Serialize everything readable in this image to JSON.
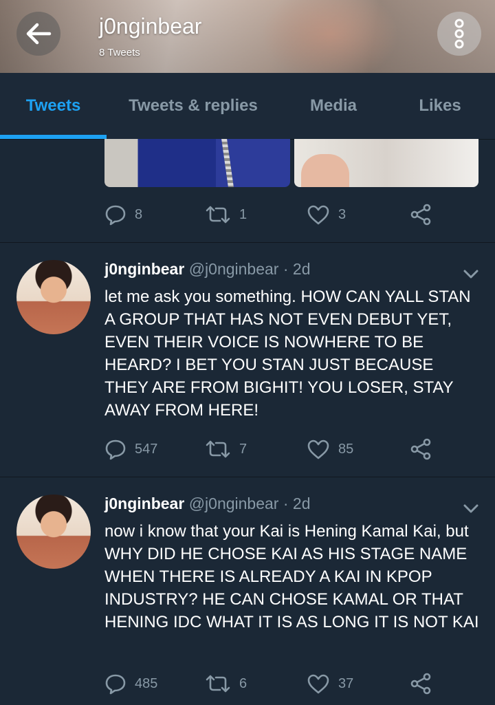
{
  "header": {
    "title": "j0nginbear",
    "subtitle": "8 Tweets"
  },
  "tabs": [
    {
      "label": "Tweets",
      "active": true
    },
    {
      "label": "Tweets & replies",
      "active": false
    },
    {
      "label": "Media",
      "active": false
    },
    {
      "label": "Likes",
      "active": false
    }
  ],
  "colors": {
    "accent": "#1da1f2",
    "background": "#1b2836",
    "muted": "#8899a6"
  },
  "icons": {
    "back": "arrow-left-icon",
    "more": "more-vertical-icon",
    "reply": "reply-icon",
    "retweet": "retweet-icon",
    "like": "heart-icon",
    "share": "share-icon",
    "caret": "chevron-down-icon"
  },
  "top_tweet": {
    "replies": "8",
    "retweets": "1",
    "likes": "3"
  },
  "tweets": [
    {
      "name": "j0nginbear",
      "handle": "@j0nginbear · 2d",
      "text": "let me ask you something. HOW CAN YALL STAN A GROUP THAT HAS NOT EVEN DEBUT YET, EVEN THEIR VOICE IS NOWHERE TO BE HEARD? I BET YOU STAN JUST BECAUSE THEY ARE FROM BIGHIT! YOU LOSER, STAY AWAY FROM HERE!",
      "replies": "547",
      "retweets": "7",
      "likes": "85"
    },
    {
      "name": "j0nginbear",
      "handle": "@j0nginbear · 2d",
      "text": "now i know that your Kai is Hening Kamal Kai, but WHY DID HE CHOSE KAI AS HIS STAGE NAME WHEN THERE IS ALREADY A KAI IN KPOP INDUSTRY? HE CAN CHOSE KAMAL OR THAT HENING IDC WHAT IT IS AS LONG IT IS NOT KAI",
      "replies": "485",
      "retweets": "6",
      "likes": "37"
    }
  ]
}
